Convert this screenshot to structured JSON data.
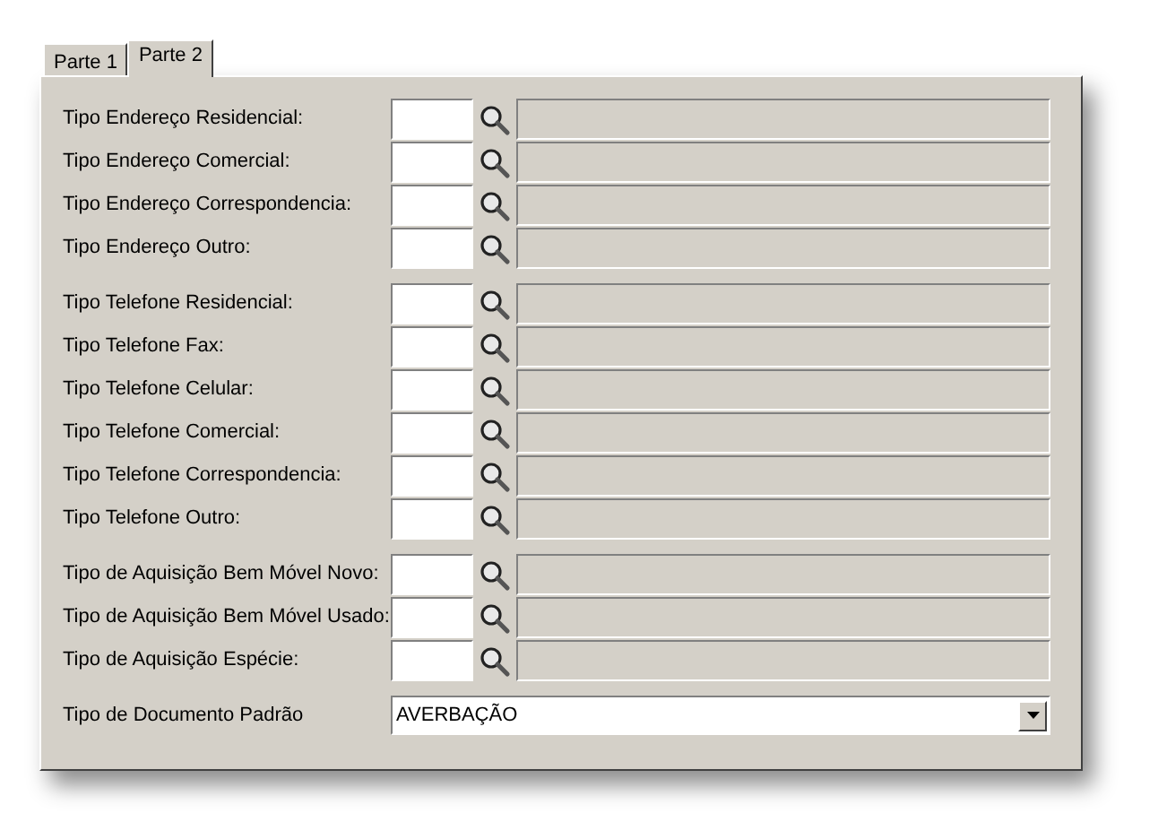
{
  "tabs": [
    {
      "label": "Parte 1",
      "selected": false
    },
    {
      "label": "Parte 2",
      "selected": true
    }
  ],
  "groups": [
    {
      "fields": [
        {
          "label": "Tipo Endereço Residencial:"
        },
        {
          "label": "Tipo Endereço Comercial:"
        },
        {
          "label": "Tipo Endereço Correspondencia:"
        },
        {
          "label": "Tipo Endereço Outro:"
        }
      ]
    },
    {
      "fields": [
        {
          "label": "Tipo Telefone Residencial:"
        },
        {
          "label": "Tipo Telefone Fax:"
        },
        {
          "label": "Tipo Telefone Celular:"
        },
        {
          "label": "Tipo Telefone Comercial:"
        },
        {
          "label": "Tipo Telefone Correspondencia:"
        },
        {
          "label": "Tipo Telefone Outro:"
        }
      ]
    },
    {
      "fields": [
        {
          "label": "Tipo de Aquisição Bem Móvel Novo:"
        },
        {
          "label": "Tipo de Aquisição Bem Móvel Usado:"
        },
        {
          "label": "Tipo de Aquisição Espécie:"
        }
      ]
    }
  ],
  "document_type": {
    "label": "Tipo de Documento Padrão",
    "value": "AVERBAÇÃO"
  }
}
